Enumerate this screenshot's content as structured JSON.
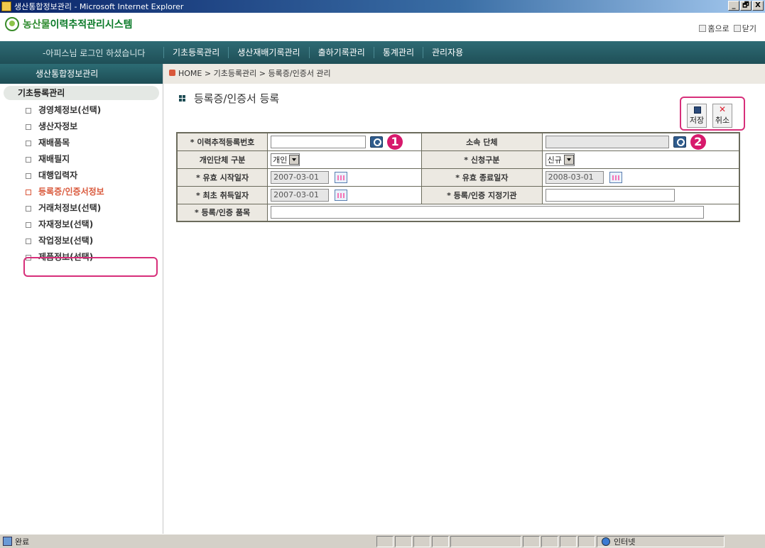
{
  "window": {
    "title": "생산통합정보관리 - Microsoft Internet Explorer",
    "buttons": [
      "_",
      "🗗",
      "X"
    ]
  },
  "header": {
    "logo_prefix": "농산물",
    "logo_suffix": "이력추적관리시스템",
    "home_link": "홈으로",
    "close_link": "닫기"
  },
  "nav": {
    "login_message": "-아피스님 로그인 하셨습니다",
    "items": [
      "기초등록관리",
      "생산재배기록관리",
      "출하기록관리",
      "통계관리",
      "관리자용"
    ]
  },
  "sidebar": {
    "title": "생산통합정보관리",
    "category": "기초등록관리",
    "items": [
      "경영체정보(선택)",
      "생산자정보",
      "재배품목",
      "재배필지",
      "대행입력자",
      "등록증/인증서정보",
      "거래처정보(선택)",
      "자재정보(선택)",
      "작업정보(선택)",
      "제품정보(선택)"
    ]
  },
  "breadcrumb": "HOME > 기초등록관리 > 등록증/인증서 관리",
  "page_title": "등록증/인증서 등록",
  "actions": {
    "save_label": "저장",
    "cancel_label": "취소"
  },
  "form": {
    "trace_no_label": "* 이력추적등록번호",
    "trace_no_value": "",
    "org_label": "소속 단체",
    "org_value": "",
    "type_label": "개인단체 구분",
    "type_value": "개인",
    "req_label": "* 신청구분",
    "req_value": "신규",
    "start_label": "* 유효 시작일자",
    "start_value": "2007-03-01",
    "end_label": "* 유효 종료일자",
    "end_value": "2008-03-01",
    "first_label": "* 최초 취득일자",
    "first_value": "2007-03-01",
    "agency_label": "* 등록/인증 지정기관",
    "agency_value": "",
    "item_label": "* 등록/인증 품목",
    "item_value": ""
  },
  "annotations": {
    "one": "1",
    "two": "2"
  },
  "status": {
    "left": "완료",
    "zone": "인터넷"
  }
}
